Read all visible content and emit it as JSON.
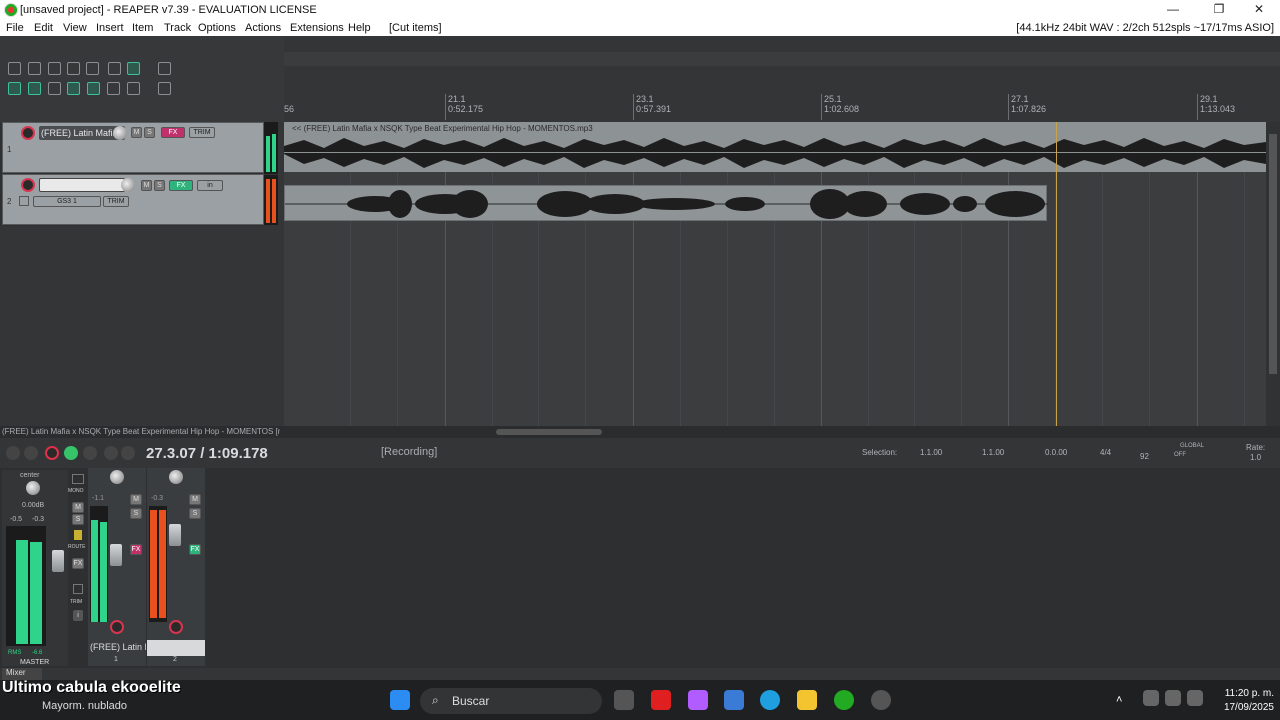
{
  "window": {
    "title": "[unsaved project] - REAPER v7.39 - EVALUATION LICENSE",
    "minimize": "—",
    "maximize": "❐",
    "close": "✕"
  },
  "menu": {
    "items": [
      "File",
      "Edit",
      "View",
      "Insert",
      "Item",
      "Track",
      "Options",
      "Actions",
      "Extensions",
      "Help"
    ],
    "cut_items": "[Cut items]",
    "audio_status": "[44.1kHz 24bit WAV : 2/2ch 512spls ~17/17ms ASIO]"
  },
  "ruler": {
    "start_label": "56",
    "markers": [
      {
        "bar": "21.1",
        "time": "0:52.175"
      },
      {
        "bar": "23.1",
        "time": "0:57.391"
      },
      {
        "bar": "25.1",
        "time": "1:02.608"
      },
      {
        "bar": "27.1",
        "time": "1:07.826"
      },
      {
        "bar": "29.1",
        "time": "1:13.043"
      }
    ]
  },
  "tracks": [
    {
      "number": "1",
      "name": "(FREE) Latin Mafia",
      "mute": "M",
      "solo": "S",
      "fx": "FX",
      "trim": "TRIM"
    },
    {
      "number": "2",
      "name": "",
      "mute": "M",
      "solo": "S",
      "fx": "FX",
      "input": "in",
      "input_label": "GS3 1",
      "trim": "TRIM"
    }
  ],
  "items": {
    "item1_label": "<< (FREE) Latin Mafia x NSQK Type Beat  Experimental Hip Hop - MOMENTOS.mp3"
  },
  "status_line": "(FREE) Latin Mafia x NSQK Type Beat  Experimental Hip Hop - MOMENTOS [mp",
  "transport": {
    "time": "27.3.07 / 1:09.178",
    "state": "[Recording]",
    "selection_label": "Selection:",
    "sel_start": "1.1.00",
    "sel_end": "1.1.00",
    "sel_len": "0.0.00",
    "time_sig": "4/4",
    "bpm": "92",
    "global_label": "GLOBAL",
    "global_state": "OFF",
    "rate_label": "Rate:",
    "rate_value": "1.0"
  },
  "mixer": {
    "master_pan": "center",
    "master_vol": "0.00dB",
    "master_peak_l": "-0.5",
    "master_peak_r": "-0.3",
    "master_rms": "RMS",
    "master_rms_val": "-6.6",
    "master_label": "MASTER",
    "mono": "MONO",
    "route": "ROUTE",
    "fx": "FX",
    "trim": "TRIM",
    "info": "i",
    "strip1_peak": "-1.1",
    "strip1_name": "(FREE) Latin M",
    "strip1_num": "1",
    "strip2_peak": "-0.3",
    "strip2_num": "2",
    "tab_label": "Mixer"
  },
  "taskbar": {
    "weather_title": "Ultimo cabula ekooelite",
    "weather_sub": "Mayorm. nublado",
    "search_placeholder": "Buscar",
    "time": "11:20 p. m.",
    "date": "17/09/2025"
  }
}
